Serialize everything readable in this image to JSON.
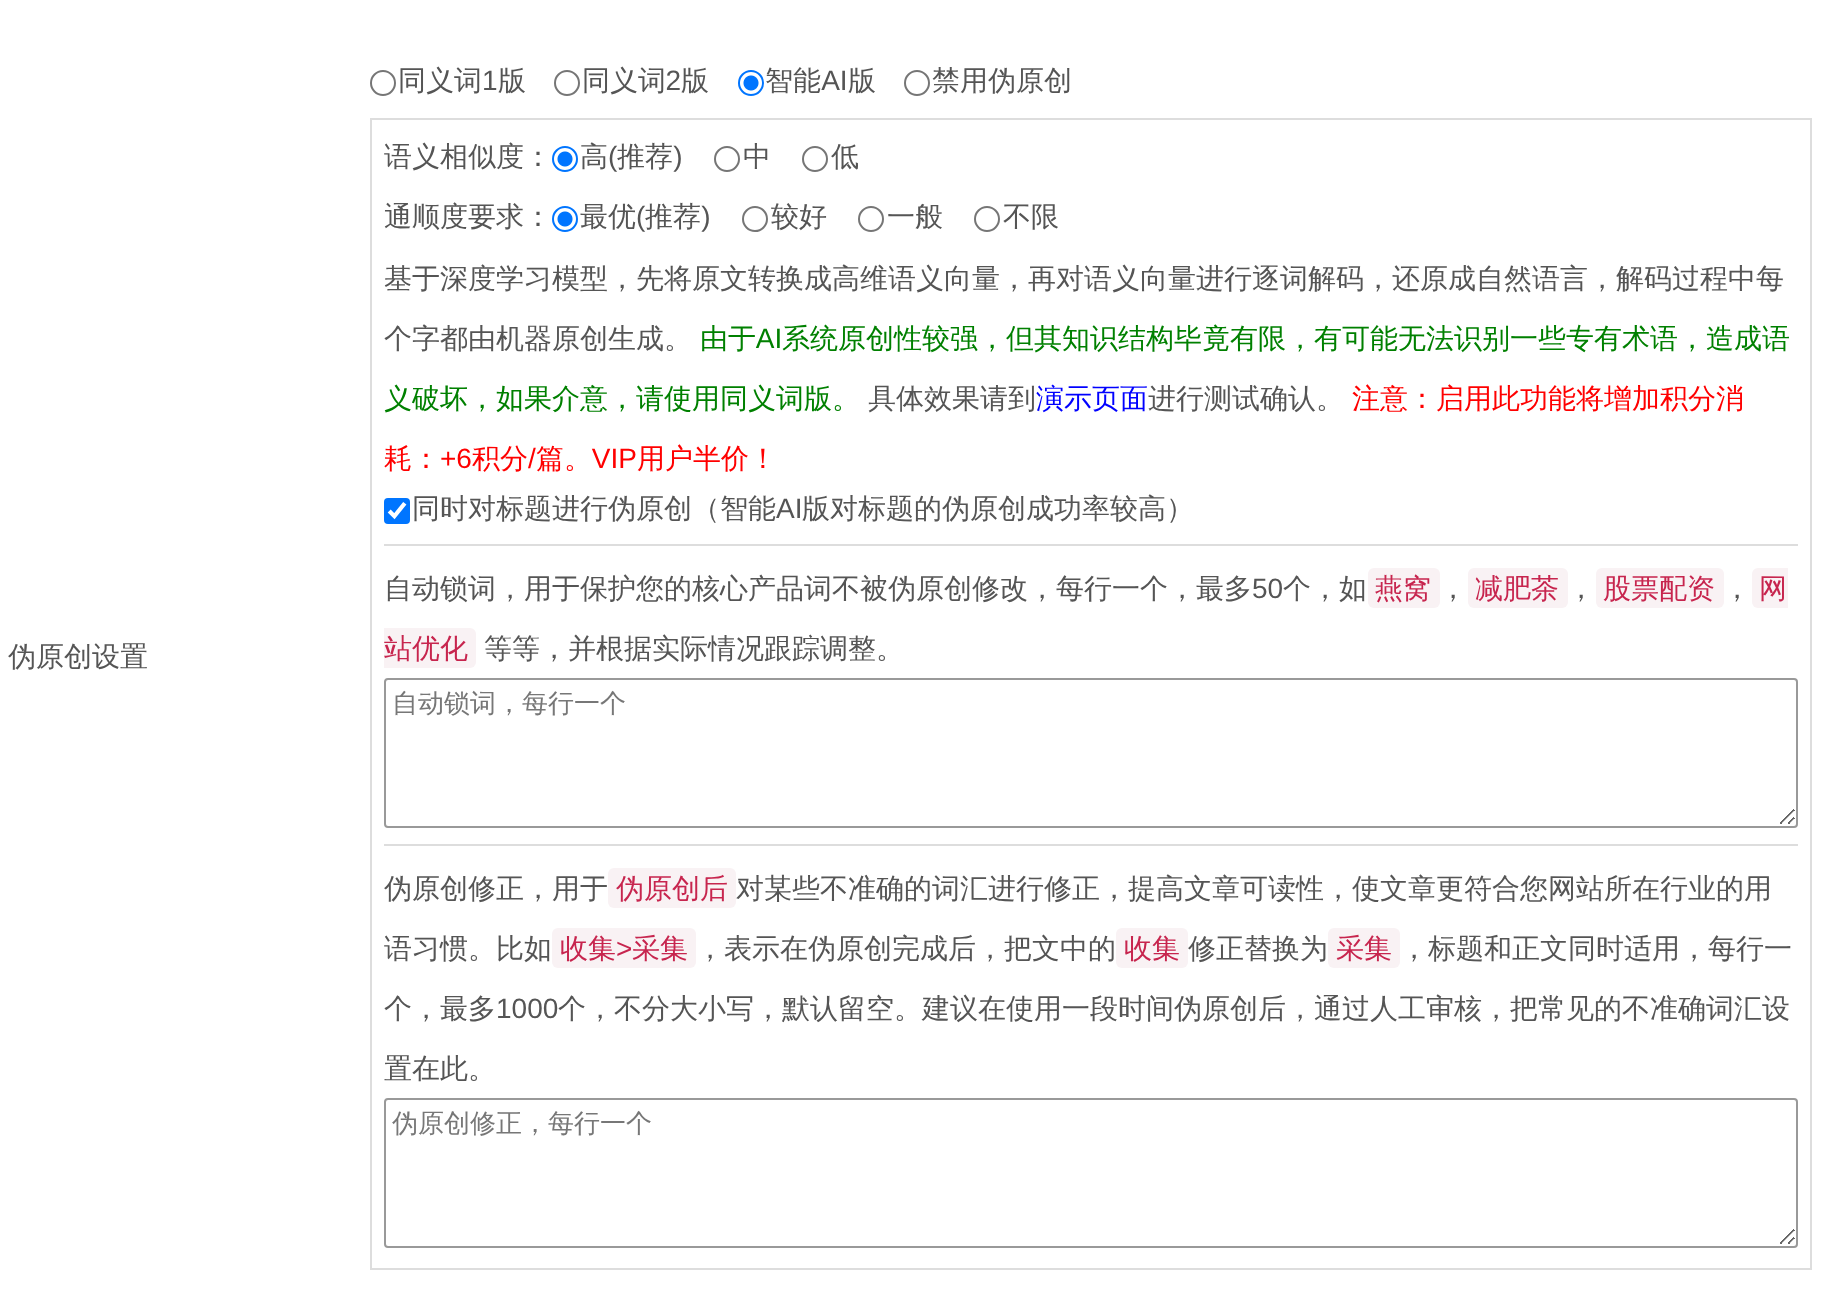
{
  "section_label": "伪原创设置",
  "mode_options": [
    {
      "label": "同义词1版",
      "selected": false
    },
    {
      "label": "同义词2版",
      "selected": false
    },
    {
      "label": "智能AI版",
      "selected": true
    },
    {
      "label": "禁用伪原创",
      "selected": false
    }
  ],
  "ai_settings": [
    {
      "label": "语义相似度：",
      "options": [
        {
          "label": "高(推荐)",
          "selected": true
        },
        {
          "label": "中",
          "selected": false
        },
        {
          "label": "低",
          "selected": false
        }
      ]
    },
    {
      "label": "通顺度要求：",
      "options": [
        {
          "label": "最优(推荐)",
          "selected": true
        },
        {
          "label": "较好",
          "selected": false
        },
        {
          "label": "一般",
          "selected": false
        },
        {
          "label": "不限",
          "selected": false
        }
      ]
    }
  ],
  "ai_description": [
    {
      "kind": "plain",
      "text": "基于深度学习模型，先将原文转换成高维语义向量，再对语义向量进行逐词解码，还原成自然语言，解码过程中每个字都由机器原创生成。 "
    },
    {
      "kind": "green",
      "text": "由于AI系统原创性较强，但其知识结构毕竟有限，有可能无法识别一些专有术语，造成语义破坏，如果介意，请使用同义词版。"
    },
    {
      "kind": "plain",
      "text": " 具体效果请到"
    },
    {
      "kind": "link",
      "text": "演示页面"
    },
    {
      "kind": "plain",
      "text": "进行测试确认。 "
    },
    {
      "kind": "red",
      "text": "注意：启用此功能将增加积分消耗：+6积分/篇。VIP用户半价！"
    }
  ],
  "title_checkbox": {
    "label": "同时对标题进行伪原创（智能AI版对标题的伪原创成功率较高）",
    "checked": true
  },
  "lock_words": {
    "description": [
      {
        "kind": "plain",
        "text": "自动锁词，用于保护您的核心产品词不被伪原创修改，每行一个，最多50个，如"
      },
      {
        "kind": "tag",
        "text": "燕窝"
      },
      {
        "kind": "plain",
        "text": "，"
      },
      {
        "kind": "tag",
        "text": "减肥茶"
      },
      {
        "kind": "plain",
        "text": "，"
      },
      {
        "kind": "tag",
        "text": "股票配资"
      },
      {
        "kind": "plain",
        "text": "，"
      },
      {
        "kind": "tag",
        "text": "网站优化"
      },
      {
        "kind": "plain",
        "text": " 等等，并根据实际情况跟踪调整。"
      }
    ],
    "placeholder": "自动锁词，每行一个"
  },
  "correction": {
    "description": [
      {
        "kind": "plain",
        "text": "伪原创修正，用于"
      },
      {
        "kind": "tag",
        "text": "伪原创后"
      },
      {
        "kind": "plain",
        "text": "对某些不准确的词汇进行修正，提高文章可读性，使文章更符合您网站所在行业的用语习惯。比如"
      },
      {
        "kind": "tag",
        "text": "收集>采集"
      },
      {
        "kind": "plain",
        "text": "，表示在伪原创完成后，把文中的"
      },
      {
        "kind": "tag",
        "text": "收集"
      },
      {
        "kind": "plain",
        "text": "修正替换为"
      },
      {
        "kind": "tag",
        "text": "采集"
      },
      {
        "kind": "plain",
        "text": "，标题和正文同时适用，每行一个，最多1000个，不分大小写，默认留空。建议在使用一段时间伪原创后，通过人工审核，把常见的不准确词汇设置在此。"
      }
    ],
    "placeholder": "伪原创修正，每行一个"
  }
}
